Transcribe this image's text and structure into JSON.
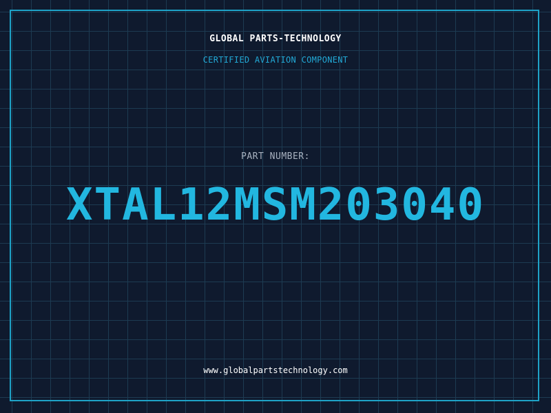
{
  "header": {
    "company": "GLOBAL PARTS-TECHNOLOGY",
    "tagline": "CERTIFIED AVIATION COMPONENT"
  },
  "part": {
    "label": "PART NUMBER:",
    "number": "XTAL12MSM203040"
  },
  "footer": {
    "website": "www.globalpartstechnology.com"
  },
  "colors": {
    "background": "#0f1a2e",
    "grid": "#1d3b52",
    "accent": "#22b7e0",
    "frame": "#1ea3c8",
    "label": "#a9b2c0",
    "text": "#ffffff"
  }
}
